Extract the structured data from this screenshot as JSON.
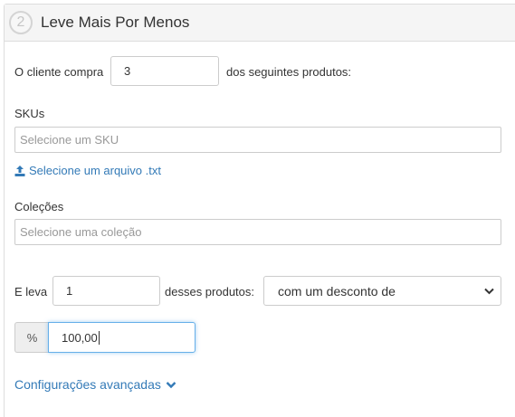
{
  "header": {
    "step_number": "2",
    "title": "Leve Mais Por Menos"
  },
  "buy_rule": {
    "prefix": "O cliente compra",
    "quantity": "3",
    "suffix": "dos seguintes produtos:"
  },
  "skus": {
    "label": "SKUs",
    "placeholder": "Selecione um SKU",
    "upload_link": "Selecione um arquivo .txt"
  },
  "collections": {
    "label": "Coleções",
    "placeholder": "Selecione uma coleção"
  },
  "take_rule": {
    "prefix": "E leva",
    "quantity": "1",
    "middle": "desses produtos:",
    "discount_type": "com um desconto de"
  },
  "discount": {
    "addon": "%",
    "value": "100,00"
  },
  "advanced": {
    "label": "Configurações avançadas"
  },
  "colors": {
    "link": "#337ab7",
    "header_bg": "#f5f5f5",
    "focus": "#66afe9"
  }
}
